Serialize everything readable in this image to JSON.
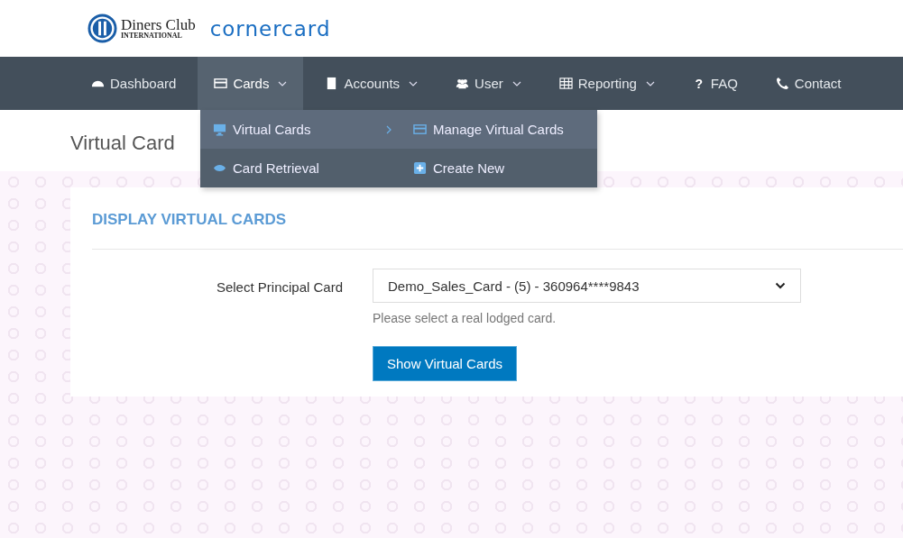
{
  "logos": {
    "diners": "Diners Club",
    "diners_sub": "INTERNATIONAL",
    "cornercard": "cornercard"
  },
  "nav": [
    {
      "label": "Dashboard",
      "selected": false,
      "has_menu": false
    },
    {
      "label": "Cards",
      "selected": true,
      "has_menu": true
    },
    {
      "label": "Accounts",
      "selected": false,
      "has_menu": true
    },
    {
      "label": "User",
      "selected": false,
      "has_menu": true
    },
    {
      "label": "Reporting",
      "selected": false,
      "has_menu": true
    },
    {
      "label": "FAQ",
      "selected": false,
      "has_menu": false,
      "icon_text": "?"
    },
    {
      "label": "Contact",
      "selected": false,
      "has_menu": false
    }
  ],
  "dropdown": {
    "items": [
      {
        "label": "Virtual Cards",
        "selected": true,
        "has_submenu": true
      },
      {
        "label": "Card Retrieval",
        "selected": false,
        "has_submenu": false
      }
    ],
    "submenu": [
      {
        "label": "Manage Virtual Cards",
        "selected": true
      },
      {
        "label": "Create New",
        "selected": false
      }
    ]
  },
  "page_title": "Virtual Card",
  "panel": {
    "heading": "DISPLAY VIRTUAL CARDS",
    "field_label": "Select Principal Card",
    "select_value": "Demo_Sales_Card - (5) - 360964****9843",
    "help": "Please select a real lodged card.",
    "button": "Show Virtual Cards"
  }
}
